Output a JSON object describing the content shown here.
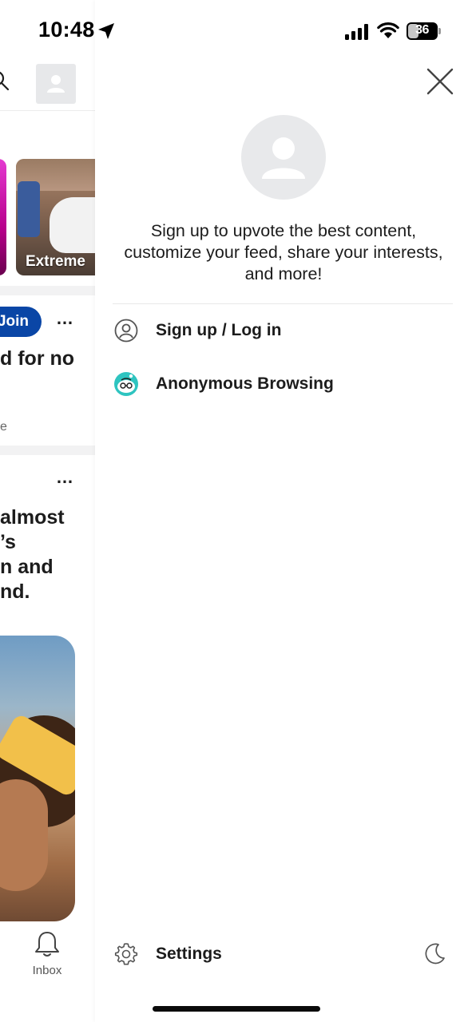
{
  "status_bar": {
    "time": "10:48",
    "battery_percent": "36",
    "battery_level": 0.36
  },
  "feed": {
    "community_card_label": "Extreme",
    "join_label": "Join",
    "more_label": "…",
    "post1_text": [
      "d for no"
    ],
    "post1_meta": "e",
    "post2_text": [
      "almost",
      "’s",
      "n and",
      "nd."
    ],
    "inbox_label": "Inbox"
  },
  "drawer": {
    "promo_text": "Sign up to upvote the best content, customize your feed, share your interests, and more!",
    "menu": [
      {
        "label": "Sign up / Log in",
        "icon": "user-circle-icon"
      },
      {
        "label": "Anonymous Browsing",
        "icon": "anonymous-snoo-icon"
      }
    ],
    "settings_label": "Settings",
    "settings_icon": "gear-icon",
    "dark_mode_icon": "moon-icon",
    "close_icon": "close-icon"
  },
  "colors": {
    "join_button": "#0a46a6",
    "avatar_bg": "#e8e9eb",
    "anon_icon": "#2ec4c0"
  }
}
